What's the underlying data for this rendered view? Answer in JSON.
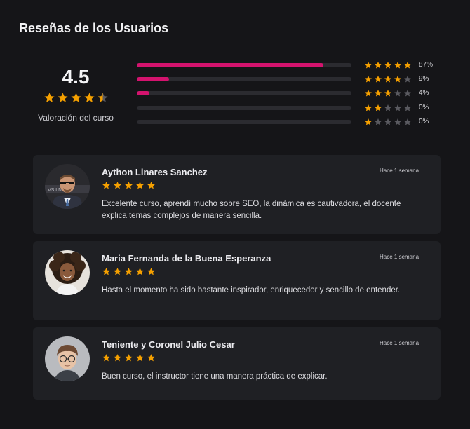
{
  "header": {
    "title": "Reseñas de los Usuarios"
  },
  "summary": {
    "score": "4.5",
    "rating": 4.5,
    "label": "Valoración del curso"
  },
  "distribution": [
    {
      "stars": 5,
      "percent_label": "87%",
      "fraction": 0.87
    },
    {
      "stars": 4,
      "percent_label": "9%",
      "fraction": 0.15
    },
    {
      "stars": 3,
      "percent_label": "4%",
      "fraction": 0.06
    },
    {
      "stars": 2,
      "percent_label": "0%",
      "fraction": 0.0
    },
    {
      "stars": 1,
      "percent_label": "0%",
      "fraction": 0.0
    }
  ],
  "reviews": [
    {
      "name": "Aython Linares Sanchez",
      "time": "Hace 1 semana",
      "rating": 5,
      "text": "Excelente curso, aprendí mucho sobre SEO, la dinámica es cautivadora, el docente explica temas complejos de manera sencilla.",
      "avatar_icon": "man-sunglasses-avatar"
    },
    {
      "name": "Maria Fernanda de la Buena Esperanza",
      "time": "Hace 1 semana",
      "rating": 5,
      "text": "Hasta el momento ha sido bastante inspirador, enriquecedor y sencillo de entender.",
      "avatar_icon": "woman-curly-hair-avatar"
    },
    {
      "name": "Teniente y Coronel Julio Cesar",
      "time": "Hace 1 semana",
      "rating": 5,
      "text": "Buen curso, el instructor tiene una manera práctica de explicar.",
      "avatar_icon": "young-man-glasses-avatar"
    }
  ],
  "colors": {
    "accent_bar": "#d4136e",
    "star_filled": "#f5a000",
    "star_empty": "#5a5a60",
    "card_bg": "#1f2024",
    "page_bg": "#151518"
  }
}
